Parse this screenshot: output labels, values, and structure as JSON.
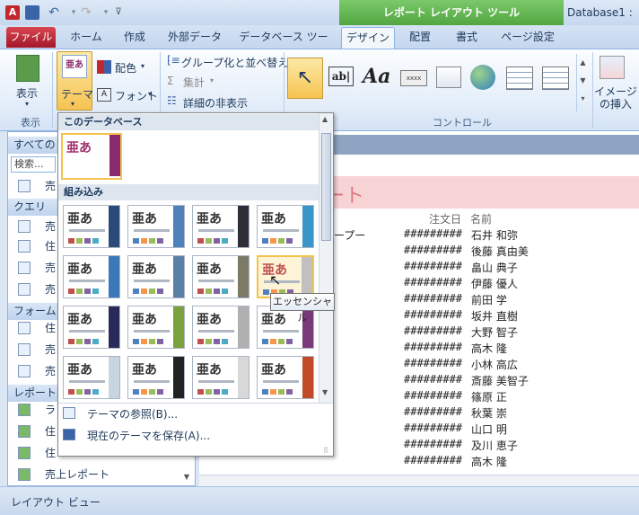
{
  "title_bar": {
    "contextual_header": "レポート レイアウト ツール",
    "app_title": "Database1 :",
    "access_icon": "A"
  },
  "tabs": [
    "ファイル",
    "ホーム",
    "作成",
    "外部データ",
    "データベース ツール",
    "デザイン",
    "配置",
    "書式",
    "ページ設定"
  ],
  "ribbon": {
    "view_label": "表示",
    "view_group": "表示",
    "theme_label": "テーマ",
    "color_label": "配色",
    "font_label": "フォント",
    "group_sort": "グループ化と並べ替え",
    "totals": "集計",
    "hide_details": "詳細の非表示",
    "controls_group": "コントロール",
    "insert_image": "イメージの挿入"
  },
  "gallery": {
    "section_this_db": "このデータベース",
    "section_builtin": "組み込み",
    "thumb_glyph": "亜あ",
    "menu_browse": "テーマの参照(B)...",
    "menu_save": "現在のテーマを保存(A)...",
    "tooltip": "エッセンシャル"
  },
  "nav": {
    "header": "すべての",
    "search_placeholder": "検索...",
    "table_item": "売",
    "sec_query": "クエリ",
    "query_items": [
      "売",
      "住",
      "売",
      "売"
    ],
    "sec_form": "フォーム",
    "form_items": [
      "住",
      "売",
      "売"
    ],
    "sec_report": "レポート",
    "report_items": [
      "ラ",
      "住",
      "住",
      "売上レポート"
    ]
  },
  "report": {
    "title_partial": "ート",
    "col_date": "注文日",
    "col_name": "名前",
    "group_label": "ープー",
    "hashes": "#########",
    "names": [
      "石井 和弥",
      "後藤 真由美",
      "畠山 典子",
      "伊藤 優人",
      "前田 学",
      "坂井 直樹",
      "大野 智子",
      "高木 隆",
      "小林 高広",
      "斎藤 美智子",
      "篠原 正",
      "秋葉 崇",
      "山口 明",
      "及川 恵子",
      "高木 隆"
    ]
  },
  "status": {
    "text": "レイアウト ビュー"
  },
  "colors": {
    "file_tab": "#c1272d",
    "context": "#5fb24c",
    "ribbon_bg": "#e3edf9",
    "gallery_hover": "#f5c24b"
  }
}
